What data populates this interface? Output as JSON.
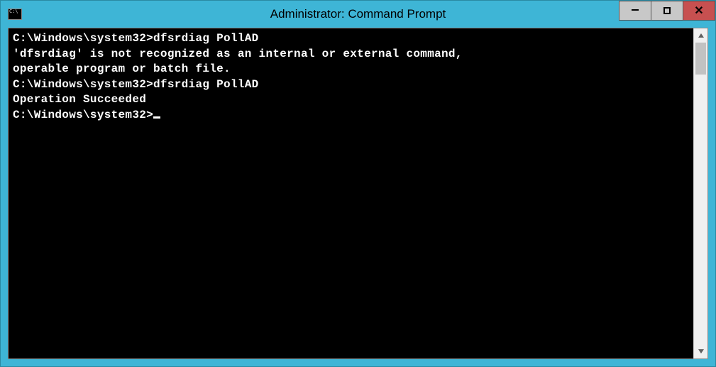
{
  "window": {
    "title": "Administrator: Command Prompt",
    "icon_text": "C:\\"
  },
  "terminal": {
    "lines": [
      "C:\\Windows\\system32>dfsrdiag PollAD",
      "'dfsrdiag' is not recognized as an internal or external command,",
      "operable program or batch file.",
      "",
      "C:\\Windows\\system32>dfsrdiag PollAD",
      "",
      "Operation Succeeded",
      "",
      "",
      "C:\\Windows\\system32>"
    ],
    "cursor_visible": true
  }
}
